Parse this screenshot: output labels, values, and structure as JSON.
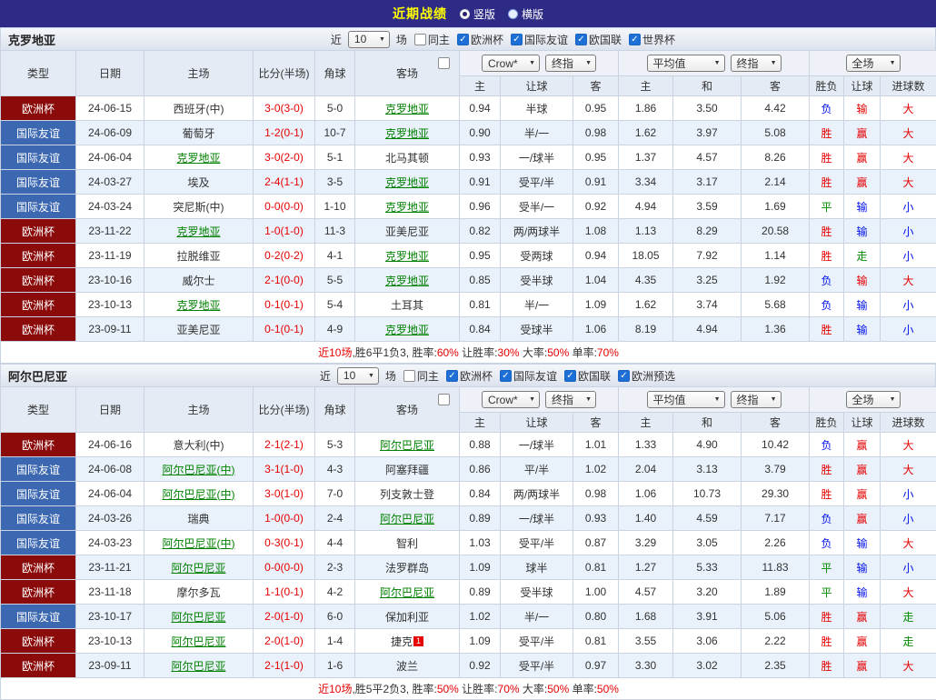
{
  "topbar": {
    "title": "近期战绩",
    "options": [
      {
        "label": "竖版",
        "selected": true
      },
      {
        "label": "横版",
        "selected": false
      }
    ]
  },
  "controls": {
    "near_label": "近",
    "count_value": "10",
    "games_label": "场",
    "same_home_label": "同主",
    "asian_company_select": "Crow*",
    "asian_index_select": "终指",
    "euro_company_select": "平均值",
    "euro_index_select": "终指",
    "scope_select": "全场"
  },
  "headers": {
    "type": "类型",
    "date": "日期",
    "home": "主场",
    "score": "比分(半场)",
    "corner": "角球",
    "away": "客场",
    "asian_home": "主",
    "asian_handicap": "让球",
    "asian_away": "客",
    "euro_home": "主",
    "euro_draw": "和",
    "euro_away": "客",
    "result": "胜负",
    "handicap_result": "让球",
    "goals": "进球数"
  },
  "colors": {
    "topbar_bg": "#2e2b87",
    "title": "#ffff00",
    "euro_league_bg": "#8b0a0a",
    "friendly_bg": "#3c67b1",
    "win_red": "#e60000",
    "lose_blue": "#0011ee",
    "draw_green": "#008800",
    "team_green": "#008000"
  },
  "sections": [
    {
      "team": "克罗地亚",
      "same_home_checked": false,
      "leagues": [
        {
          "label": "欧洲杯",
          "checked": true
        },
        {
          "label": "国际友谊",
          "checked": true
        },
        {
          "label": "欧国联",
          "checked": true
        },
        {
          "label": "世界杯",
          "checked": true
        }
      ],
      "rows": [
        {
          "type": "欧洲杯",
          "type_style": "euro",
          "date": "24-06-15",
          "home": "西班牙(中)",
          "home_is_team": false,
          "score": "3-0(3-0)",
          "corner": "5-0",
          "away": "克罗地亚",
          "away_is_team": true,
          "asian_home": "0.94",
          "handicap": "半球",
          "asian_away": "0.95",
          "euro_home": "1.86",
          "euro_draw": "3.50",
          "euro_away": "4.42",
          "result": "负",
          "result_color": "blue",
          "handicap_result": "输",
          "handicap_result_color": "red",
          "goals": "大",
          "goals_color": "red"
        },
        {
          "type": "国际友谊",
          "type_style": "friendly",
          "date": "24-06-09",
          "home": "葡萄牙",
          "home_is_team": false,
          "score": "1-2(0-1)",
          "corner": "10-7",
          "away": "克罗地亚",
          "away_is_team": true,
          "asian_home": "0.90",
          "handicap": "半/一",
          "asian_away": "0.98",
          "euro_home": "1.62",
          "euro_draw": "3.97",
          "euro_away": "5.08",
          "result": "胜",
          "result_color": "red",
          "handicap_result": "赢",
          "handicap_result_color": "red",
          "goals": "大",
          "goals_color": "red"
        },
        {
          "type": "国际友谊",
          "type_style": "friendly",
          "date": "24-06-04",
          "home": "克罗地亚",
          "home_is_team": true,
          "score": "3-0(2-0)",
          "corner": "5-1",
          "away": "北马其顿",
          "away_is_team": false,
          "asian_home": "0.93",
          "handicap": "一/球半",
          "asian_away": "0.95",
          "euro_home": "1.37",
          "euro_draw": "4.57",
          "euro_away": "8.26",
          "result": "胜",
          "result_color": "red",
          "handicap_result": "赢",
          "handicap_result_color": "red",
          "goals": "大",
          "goals_color": "red"
        },
        {
          "type": "国际友谊",
          "type_style": "friendly",
          "date": "24-03-27",
          "home": "埃及",
          "home_is_team": false,
          "score": "2-4(1-1)",
          "corner": "3-5",
          "away": "克罗地亚",
          "away_is_team": true,
          "asian_home": "0.91",
          "handicap": "受平/半",
          "asian_away": "0.91",
          "euro_home": "3.34",
          "euro_draw": "3.17",
          "euro_away": "2.14",
          "result": "胜",
          "result_color": "red",
          "handicap_result": "赢",
          "handicap_result_color": "red",
          "goals": "大",
          "goals_color": "red"
        },
        {
          "type": "国际友谊",
          "type_style": "friendly",
          "date": "24-03-24",
          "home": "突尼斯(中)",
          "home_is_team": false,
          "score": "0-0(0-0)",
          "corner": "1-10",
          "away": "克罗地亚",
          "away_is_team": true,
          "asian_home": "0.96",
          "handicap": "受半/一",
          "asian_away": "0.92",
          "euro_home": "4.94",
          "euro_draw": "3.59",
          "euro_away": "1.69",
          "result": "平",
          "result_color": "green",
          "handicap_result": "输",
          "handicap_result_color": "blue",
          "goals": "小",
          "goals_color": "blue"
        },
        {
          "type": "欧洲杯",
          "type_style": "euro",
          "date": "23-11-22",
          "home": "克罗地亚",
          "home_is_team": true,
          "score": "1-0(1-0)",
          "corner": "11-3",
          "away": "亚美尼亚",
          "away_is_team": false,
          "asian_home": "0.82",
          "handicap": "两/两球半",
          "asian_away": "1.08",
          "euro_home": "1.13",
          "euro_draw": "8.29",
          "euro_away": "20.58",
          "result": "胜",
          "result_color": "red",
          "handicap_result": "输",
          "handicap_result_color": "blue",
          "goals": "小",
          "goals_color": "blue"
        },
        {
          "type": "欧洲杯",
          "type_style": "euro",
          "date": "23-11-19",
          "home": "拉脱维亚",
          "home_is_team": false,
          "score": "0-2(0-2)",
          "corner": "4-1",
          "away": "克罗地亚",
          "away_is_team": true,
          "asian_home": "0.95",
          "handicap": "受两球",
          "asian_away": "0.94",
          "euro_home": "18.05",
          "euro_draw": "7.92",
          "euro_away": "1.14",
          "result": "胜",
          "result_color": "red",
          "handicap_result": "走",
          "handicap_result_color": "green",
          "goals": "小",
          "goals_color": "blue"
        },
        {
          "type": "欧洲杯",
          "type_style": "euro",
          "date": "23-10-16",
          "home": "威尔士",
          "home_is_team": false,
          "score": "2-1(0-0)",
          "corner": "5-5",
          "away": "克罗地亚",
          "away_is_team": true,
          "asian_home": "0.85",
          "handicap": "受半球",
          "asian_away": "1.04",
          "euro_home": "4.35",
          "euro_draw": "3.25",
          "euro_away": "1.92",
          "result": "负",
          "result_color": "blue",
          "handicap_result": "输",
          "handicap_result_color": "red",
          "goals": "大",
          "goals_color": "red"
        },
        {
          "type": "欧洲杯",
          "type_style": "euro",
          "date": "23-10-13",
          "home": "克罗地亚",
          "home_is_team": true,
          "score": "0-1(0-1)",
          "corner": "5-4",
          "away": "土耳其",
          "away_is_team": false,
          "asian_home": "0.81",
          "handicap": "半/一",
          "asian_away": "1.09",
          "euro_home": "1.62",
          "euro_draw": "3.74",
          "euro_away": "5.68",
          "result": "负",
          "result_color": "blue",
          "handicap_result": "输",
          "handicap_result_color": "blue",
          "goals": "小",
          "goals_color": "blue"
        },
        {
          "type": "欧洲杯",
          "type_style": "euro",
          "date": "23-09-11",
          "home": "亚美尼亚",
          "home_is_team": false,
          "score": "0-1(0-1)",
          "corner": "4-9",
          "away": "克罗地亚",
          "away_is_team": true,
          "asian_home": "0.84",
          "handicap": "受球半",
          "asian_away": "1.06",
          "euro_home": "8.19",
          "euro_draw": "4.94",
          "euro_away": "1.36",
          "result": "胜",
          "result_color": "red",
          "handicap_result": "输",
          "handicap_result_color": "blue",
          "goals": "小",
          "goals_color": "blue"
        }
      ],
      "summary": [
        {
          "text": "近10场",
          "color": "red"
        },
        {
          "text": ",胜6平1负3, 胜率:",
          "color": "dark"
        },
        {
          "text": "60%",
          "color": "red"
        },
        {
          "text": " 让胜率:",
          "color": "dark"
        },
        {
          "text": "30%",
          "color": "red"
        },
        {
          "text": " 大率:",
          "color": "dark"
        },
        {
          "text": "50%",
          "color": "red"
        },
        {
          "text": " 单率:",
          "color": "dark"
        },
        {
          "text": "70%",
          "color": "red"
        }
      ]
    },
    {
      "team": "阿尔巴尼亚",
      "same_home_checked": false,
      "leagues": [
        {
          "label": "欧洲杯",
          "checked": true
        },
        {
          "label": "国际友谊",
          "checked": true
        },
        {
          "label": "欧国联",
          "checked": true
        },
        {
          "label": "欧洲预选",
          "checked": true
        }
      ],
      "rows": [
        {
          "type": "欧洲杯",
          "type_style": "euro",
          "date": "24-06-16",
          "home": "意大利(中)",
          "home_is_team": false,
          "score": "2-1(2-1)",
          "corner": "5-3",
          "away": "阿尔巴尼亚",
          "away_is_team": true,
          "asian_home": "0.88",
          "handicap": "一/球半",
          "asian_away": "1.01",
          "euro_home": "1.33",
          "euro_draw": "4.90",
          "euro_away": "10.42",
          "result": "负",
          "result_color": "blue",
          "handicap_result": "赢",
          "handicap_result_color": "red",
          "goals": "大",
          "goals_color": "red"
        },
        {
          "type": "国际友谊",
          "type_style": "friendly",
          "date": "24-06-08",
          "home": "阿尔巴尼亚(中)",
          "home_is_team": true,
          "score": "3-1(1-0)",
          "corner": "4-3",
          "away": "阿塞拜疆",
          "away_is_team": false,
          "asian_home": "0.86",
          "handicap": "平/半",
          "asian_away": "1.02",
          "euro_home": "2.04",
          "euro_draw": "3.13",
          "euro_away": "3.79",
          "result": "胜",
          "result_color": "red",
          "handicap_result": "赢",
          "handicap_result_color": "red",
          "goals": "大",
          "goals_color": "red"
        },
        {
          "type": "国际友谊",
          "type_style": "friendly",
          "date": "24-06-04",
          "home": "阿尔巴尼亚(中)",
          "home_is_team": true,
          "score": "3-0(1-0)",
          "corner": "7-0",
          "away": "列支敦士登",
          "away_is_team": false,
          "asian_home": "0.84",
          "handicap": "两/两球半",
          "asian_away": "0.98",
          "euro_home": "1.06",
          "euro_draw": "10.73",
          "euro_away": "29.30",
          "result": "胜",
          "result_color": "red",
          "handicap_result": "赢",
          "handicap_result_color": "red",
          "goals": "小",
          "goals_color": "blue"
        },
        {
          "type": "国际友谊",
          "type_style": "friendly",
          "date": "24-03-26",
          "home": "瑞典",
          "home_is_team": false,
          "score": "1-0(0-0)",
          "corner": "2-4",
          "away": "阿尔巴尼亚",
          "away_is_team": true,
          "asian_home": "0.89",
          "handicap": "一/球半",
          "asian_away": "0.93",
          "euro_home": "1.40",
          "euro_draw": "4.59",
          "euro_away": "7.17",
          "result": "负",
          "result_color": "blue",
          "handicap_result": "赢",
          "handicap_result_color": "red",
          "goals": "小",
          "goals_color": "blue"
        },
        {
          "type": "国际友谊",
          "type_style": "friendly",
          "date": "24-03-23",
          "home": "阿尔巴尼亚(中)",
          "home_is_team": true,
          "score": "0-3(0-1)",
          "corner": "4-4",
          "away": "智利",
          "away_is_team": false,
          "asian_home": "1.03",
          "handicap": "受平/半",
          "asian_away": "0.87",
          "euro_home": "3.29",
          "euro_draw": "3.05",
          "euro_away": "2.26",
          "result": "负",
          "result_color": "blue",
          "handicap_result": "输",
          "handicap_result_color": "blue",
          "goals": "大",
          "goals_color": "red"
        },
        {
          "type": "欧洲杯",
          "type_style": "euro",
          "date": "23-11-21",
          "home": "阿尔巴尼亚",
          "home_is_team": true,
          "score": "0-0(0-0)",
          "corner": "2-3",
          "away": "法罗群岛",
          "away_is_team": false,
          "asian_home": "1.09",
          "handicap": "球半",
          "asian_away": "0.81",
          "euro_home": "1.27",
          "euro_draw": "5.33",
          "euro_away": "11.83",
          "result": "平",
          "result_color": "green",
          "handicap_result": "输",
          "handicap_result_color": "blue",
          "goals": "小",
          "goals_color": "blue"
        },
        {
          "type": "欧洲杯",
          "type_style": "euro",
          "date": "23-11-18",
          "home": "摩尔多瓦",
          "home_is_team": false,
          "score": "1-1(0-1)",
          "corner": "4-2",
          "away": "阿尔巴尼亚",
          "away_is_team": true,
          "asian_home": "0.89",
          "handicap": "受半球",
          "asian_away": "1.00",
          "euro_home": "4.57",
          "euro_draw": "3.20",
          "euro_away": "1.89",
          "result": "平",
          "result_color": "green",
          "handicap_result": "输",
          "handicap_result_color": "blue",
          "goals": "大",
          "goals_color": "red"
        },
        {
          "type": "国际友谊",
          "type_style": "friendly",
          "date": "23-10-17",
          "home": "阿尔巴尼亚",
          "home_is_team": true,
          "score": "2-0(1-0)",
          "corner": "6-0",
          "away": "保加利亚",
          "away_is_team": false,
          "asian_home": "1.02",
          "handicap": "半/一",
          "asian_away": "0.80",
          "euro_home": "1.68",
          "euro_draw": "3.91",
          "euro_away": "5.06",
          "result": "胜",
          "result_color": "red",
          "handicap_result": "赢",
          "handicap_result_color": "red",
          "goals": "走",
          "goals_color": "green"
        },
        {
          "type": "欧洲杯",
          "type_style": "euro",
          "date": "23-10-13",
          "home": "阿尔巴尼亚",
          "home_is_team": true,
          "score": "2-0(1-0)",
          "corner": "1-4",
          "away": "捷克",
          "away_is_team": false,
          "away_badge": "1",
          "asian_home": "1.09",
          "handicap": "受平/半",
          "asian_away": "0.81",
          "euro_home": "3.55",
          "euro_draw": "3.06",
          "euro_away": "2.22",
          "result": "胜",
          "result_color": "red",
          "handicap_result": "赢",
          "handicap_result_color": "red",
          "goals": "走",
          "goals_color": "green"
        },
        {
          "type": "欧洲杯",
          "type_style": "euro",
          "date": "23-09-11",
          "home": "阿尔巴尼亚",
          "home_is_team": true,
          "score": "2-1(1-0)",
          "corner": "1-6",
          "away": "波兰",
          "away_is_team": false,
          "asian_home": "0.92",
          "handicap": "受平/半",
          "asian_away": "0.97",
          "euro_home": "3.30",
          "euro_draw": "3.02",
          "euro_away": "2.35",
          "result": "胜",
          "result_color": "red",
          "handicap_result": "赢",
          "handicap_result_color": "red",
          "goals": "大",
          "goals_color": "red"
        }
      ],
      "summary": [
        {
          "text": "近10场",
          "color": "red"
        },
        {
          "text": ",胜5平2负3, 胜率:",
          "color": "dark"
        },
        {
          "text": "50%",
          "color": "red"
        },
        {
          "text": " 让胜率:",
          "color": "dark"
        },
        {
          "text": "70%",
          "color": "red"
        },
        {
          "text": " 大率:",
          "color": "dark"
        },
        {
          "text": "50%",
          "color": "red"
        },
        {
          "text": " 单率:",
          "color": "dark"
        },
        {
          "text": "50%",
          "color": "red"
        }
      ]
    }
  ]
}
